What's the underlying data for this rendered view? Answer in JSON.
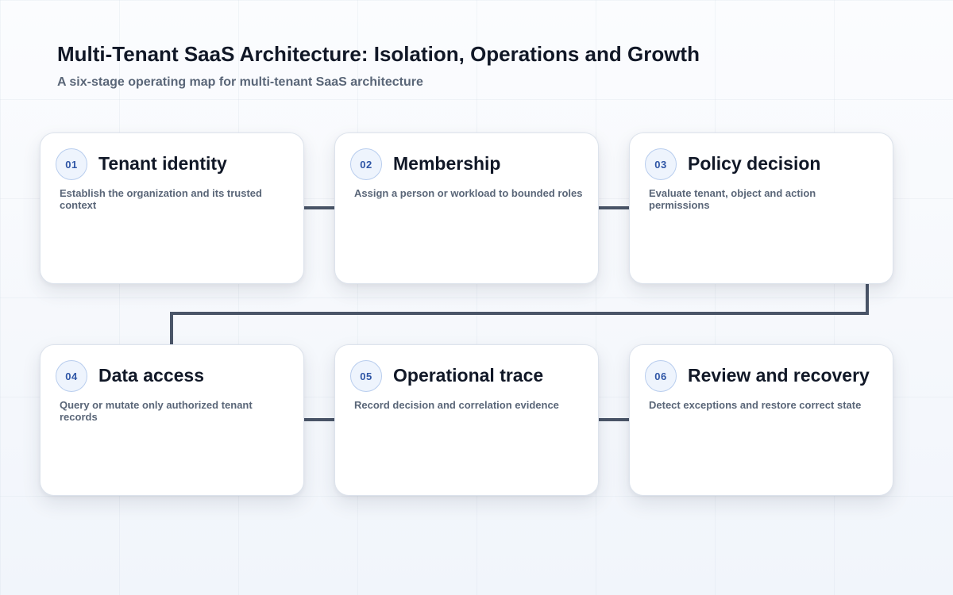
{
  "header": {
    "title": "Multi-Tenant SaaS Architecture: Isolation, Operations and Growth",
    "subtitle": "A six-stage operating map for multi-tenant SaaS architecture"
  },
  "stages": [
    {
      "number": "01",
      "title": "Tenant identity",
      "description": "Establish the organization and its trusted context"
    },
    {
      "number": "02",
      "title": "Membership",
      "description": "Assign a person or workload to bounded roles"
    },
    {
      "number": "03",
      "title": "Policy decision",
      "description": "Evaluate tenant, object and action permissions"
    },
    {
      "number": "04",
      "title": "Data access",
      "description": "Query or mutate only authorized tenant records"
    },
    {
      "number": "05",
      "title": "Operational trace",
      "description": "Record decision and correlation evidence"
    },
    {
      "number": "06",
      "title": "Review and recovery",
      "description": "Detect exceptions and restore correct state"
    }
  ],
  "colors": {
    "connector": "#4a5568",
    "badge_text": "#2f56a6",
    "badge_border": "#b8cdee"
  }
}
